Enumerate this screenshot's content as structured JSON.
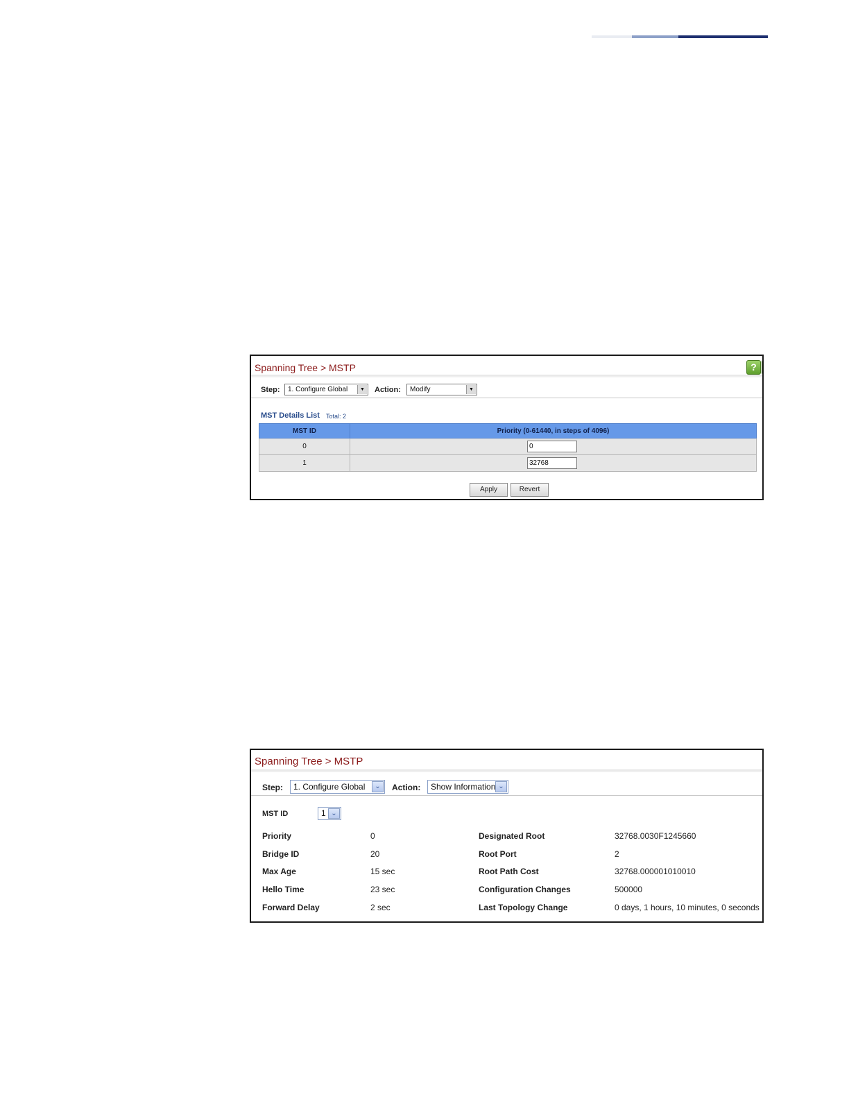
{
  "panel1": {
    "title": "Spanning Tree > MSTP",
    "step_label": "Step:",
    "step_value": "1. Configure Global",
    "action_label": "Action:",
    "action_value": "Modify",
    "list_title": "MST Details List",
    "list_total": "Total: 2",
    "columns": [
      "MST ID",
      "Priority (0-61440, in steps of 4096)"
    ],
    "rows": [
      {
        "mst_id": "0",
        "priority": "0"
      },
      {
        "mst_id": "1",
        "priority": "32768"
      }
    ],
    "apply_label": "Apply",
    "revert_label": "Revert",
    "help_icon": "?"
  },
  "panel2": {
    "title": "Spanning Tree > MSTP",
    "step_label": "Step:",
    "step_value": "1. Configure Global",
    "action_label": "Action:",
    "action_value": "Show Information",
    "mst_id_label": "MST ID",
    "mst_id_value": "1",
    "left_fields": [
      {
        "label": "Priority",
        "value": "0"
      },
      {
        "label": "Bridge ID",
        "value": "20"
      },
      {
        "label": "Max Age",
        "value": "15 sec"
      },
      {
        "label": "Hello Time",
        "value": "23 sec"
      },
      {
        "label": "Forward Delay",
        "value": "2 sec"
      }
    ],
    "right_fields": [
      {
        "label": "Designated Root",
        "value": "32768.0030F1245660"
      },
      {
        "label": "Root Port",
        "value": "2"
      },
      {
        "label": "Root Path Cost",
        "value": "32768.000001010010"
      },
      {
        "label": "Configuration Changes",
        "value": "500000"
      },
      {
        "label": "Last Topology Change",
        "value": "0 days, 1 hours, 10 minutes, 0 seconds"
      }
    ]
  }
}
